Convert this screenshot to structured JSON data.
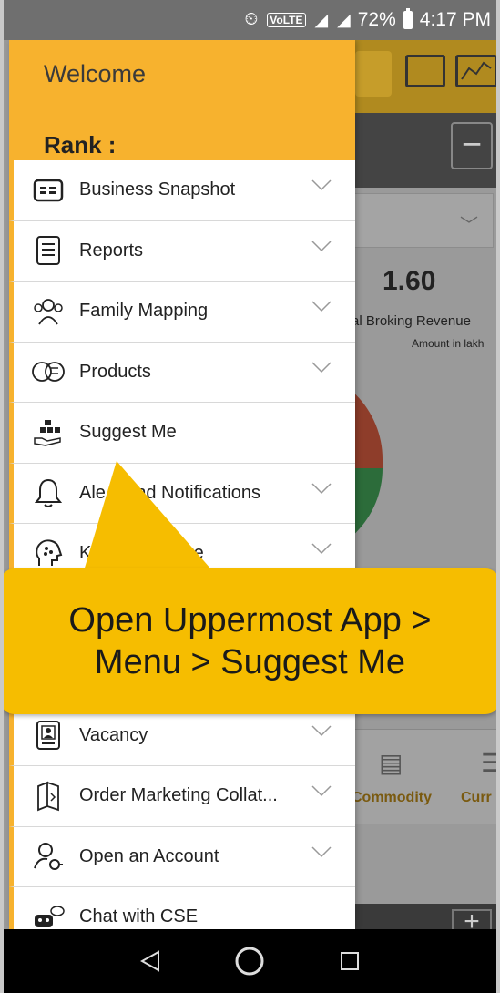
{
  "status_bar": {
    "battery": "72%",
    "time": "4:17 PM",
    "icons": [
      "alarm-icon",
      "volte-icon",
      "4g-signal-icon",
      "no-signal-icon",
      "battery-icon"
    ]
  },
  "background": {
    "value": "1.60",
    "label": "al Broking Revenue",
    "sublabel": "Amount in lakh",
    "tabs": [
      "Commodity",
      "Curr"
    ]
  },
  "drawer": {
    "welcome": "Welcome",
    "rank": "Rank :",
    "items": [
      {
        "label": "Business Snapshot",
        "icon": "id-card-icon",
        "chevron": true
      },
      {
        "label": "Reports",
        "icon": "document-list-icon",
        "chevron": true
      },
      {
        "label": "Family Mapping",
        "icon": "people-group-icon",
        "chevron": true
      },
      {
        "label": "Products",
        "icon": "coins-icon",
        "chevron": true
      },
      {
        "label": "Suggest Me",
        "icon": "hand-blocks-icon",
        "chevron": false
      },
      {
        "label": "Ale      nd Notifications",
        "icon": "bell-icon",
        "chevron": true
      },
      {
        "label": "K                ntre",
        "icon": "brain-head-icon",
        "chevron": true
      },
      {
        "label": "",
        "icon": "",
        "chevron": false
      },
      {
        "label": "",
        "icon": "",
        "chevron": false
      },
      {
        "label": "Vacancy",
        "icon": "vacancy-icon",
        "chevron": true
      },
      {
        "label": "Order Marketing Collat...",
        "icon": "brochure-icon",
        "chevron": true
      },
      {
        "label": "Open an Account",
        "icon": "user-key-icon",
        "chevron": true
      },
      {
        "label": "Chat with CSE",
        "icon": "chat-bot-icon",
        "chevron": false
      }
    ]
  },
  "callout": {
    "line1": "Open Uppermost App >",
    "line2": "Menu > Suggest Me"
  },
  "colors": {
    "accent": "#f7b22e",
    "callout": "#f6bd00"
  }
}
